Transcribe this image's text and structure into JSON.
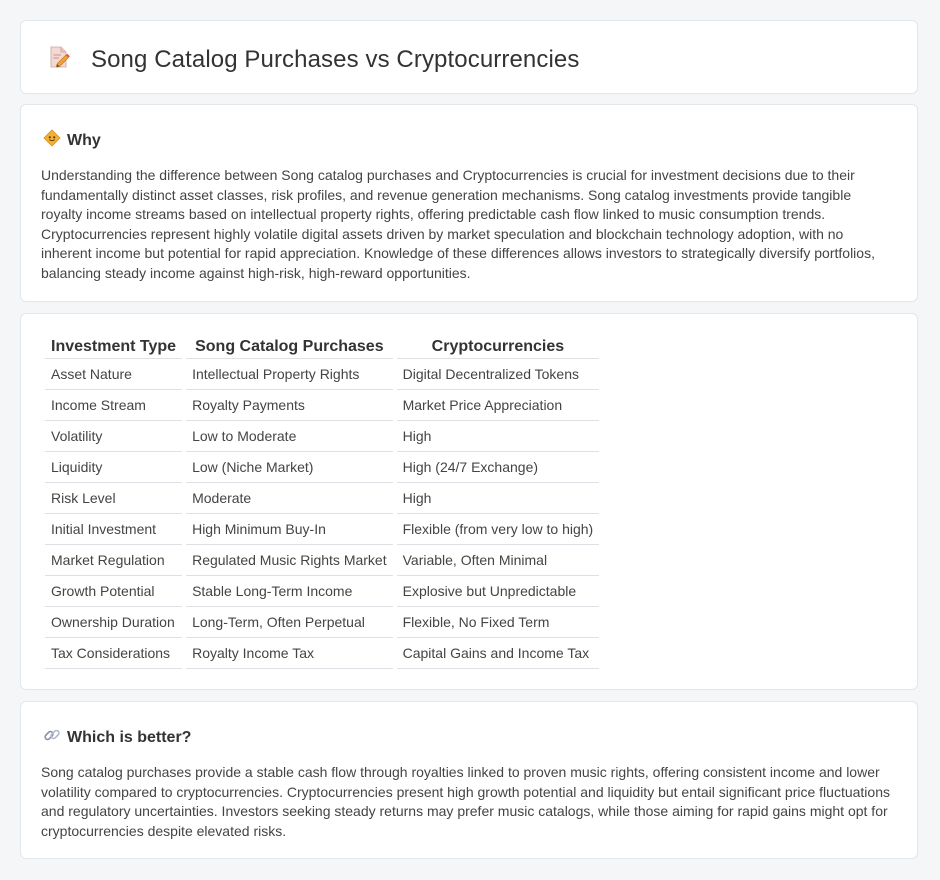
{
  "header": {
    "title": "Song Catalog Purchases vs Cryptocurrencies",
    "icon": "document-pencil-icon"
  },
  "why": {
    "heading": "Why",
    "icon": "diamond-icon",
    "text": "Understanding the difference between Song catalog purchases and Cryptocurrencies is crucial for investment decisions due to their fundamentally distinct asset classes, risk profiles, and revenue generation mechanisms. Song catalog investments provide tangible royalty income streams based on intellectual property rights, offering predictable cash flow linked to music consumption trends. Cryptocurrencies represent highly volatile digital assets driven by market speculation and blockchain technology adoption, with no inherent income but potential for rapid appreciation. Knowledge of these differences allows investors to strategically diversify portfolios, balancing steady income against high-risk, high-reward opportunities."
  },
  "table": {
    "headers": [
      "Investment Type",
      "Song Catalog Purchases",
      "Cryptocurrencies"
    ],
    "rows": [
      [
        "Asset Nature",
        "Intellectual Property Rights",
        "Digital Decentralized Tokens"
      ],
      [
        "Income Stream",
        "Royalty Payments",
        "Market Price Appreciation"
      ],
      [
        "Volatility",
        "Low to Moderate",
        "High"
      ],
      [
        "Liquidity",
        "Low (Niche Market)",
        "High (24/7 Exchange)"
      ],
      [
        "Risk Level",
        "Moderate",
        "High"
      ],
      [
        "Initial Investment",
        "High Minimum Buy-In",
        "Flexible (from very low to high)"
      ],
      [
        "Market Regulation",
        "Regulated Music Rights Market",
        "Variable, Often Minimal"
      ],
      [
        "Growth Potential",
        "Stable Long-Term Income",
        "Explosive but Unpredictable"
      ],
      [
        "Ownership Duration",
        "Long-Term, Often Perpetual",
        "Flexible, No Fixed Term"
      ],
      [
        "Tax Considerations",
        "Royalty Income Tax",
        "Capital Gains and Income Tax"
      ]
    ]
  },
  "better": {
    "heading": "Which is better?",
    "icon": "link-icon",
    "text": "Song catalog purchases provide a stable cash flow through royalties linked to proven music rights, offering consistent income and lower volatility compared to cryptocurrencies. Cryptocurrencies present high growth potential and liquidity but entail significant price fluctuations and regulatory uncertainties. Investors seeking steady returns may prefer music catalogs, while those aiming for rapid gains might opt for cryptocurrencies despite elevated risks."
  }
}
